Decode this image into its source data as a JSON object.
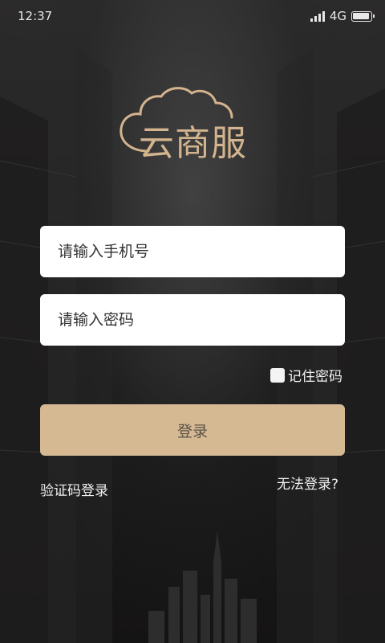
{
  "status_bar": {
    "time": "12:37",
    "network": "4G"
  },
  "logo": {
    "text": "云商服",
    "color": "#d3b48e"
  },
  "form": {
    "phone_placeholder": "请输入手机号",
    "password_placeholder": "请输入密码",
    "remember_label": "记住密码",
    "login_label": "登录"
  },
  "links": {
    "sms_login": "验证码登录",
    "cant_login": "无法登录?"
  },
  "colors": {
    "accent": "#d5b993",
    "background": "#222121"
  }
}
